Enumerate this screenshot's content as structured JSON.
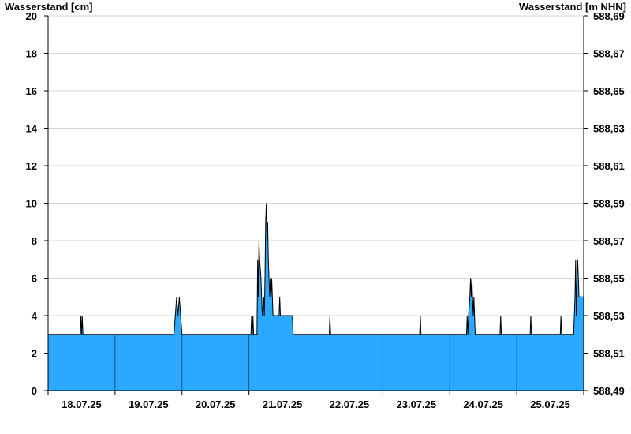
{
  "chart_data": {
    "type": "area",
    "y_left_label": "Wasserstand [cm]",
    "y_right_label": "Wasserstand [m NHN]",
    "ylim": [
      0,
      20
    ],
    "y_ticks": [
      "0",
      "2",
      "4",
      "6",
      "8",
      "10",
      "12",
      "14",
      "16",
      "18",
      "20"
    ],
    "y_right_ticks": [
      "588,49",
      "588,51",
      "588,53",
      "588,55",
      "588,57",
      "588,59",
      "588,61",
      "588,63",
      "588,65",
      "588,67",
      "588,69"
    ],
    "x_range_days": [
      17.0,
      25.0
    ],
    "x_tick_labels": [
      "18.07.25",
      "19.07.25",
      "20.07.25",
      "21.07.25",
      "22.07.25",
      "23.07.25",
      "24.07.25",
      "25.07.25"
    ],
    "grid": true,
    "fill_color": "#29a9ff",
    "line_color": "#000000",
    "series": [
      {
        "x": [
          17.0,
          17.48,
          17.49,
          17.5,
          17.51,
          17.52,
          18.88,
          18.9,
          18.92,
          18.94,
          18.96,
          18.98,
          19.0,
          19.02,
          20.03,
          20.04,
          20.05,
          20.06,
          20.07,
          20.12,
          20.13,
          20.14,
          20.15,
          20.16,
          20.18,
          20.2,
          20.22,
          20.23,
          20.24,
          20.25,
          20.26,
          20.27,
          20.28,
          20.29,
          20.3,
          20.31,
          20.32,
          20.33,
          20.34,
          20.35,
          20.36,
          20.37,
          20.38,
          20.4,
          20.45,
          20.46,
          20.47,
          20.48,
          20.55,
          20.56,
          20.65,
          20.66,
          21.2,
          21.21,
          21.22,
          21.23,
          22.55,
          22.56,
          22.57,
          22.58,
          23.25,
          23.26,
          23.27,
          23.28,
          23.3,
          23.31,
          23.32,
          23.33,
          23.34,
          23.35,
          23.36,
          23.37,
          23.38,
          23.4,
          23.42,
          23.43,
          23.75,
          23.76,
          23.77,
          23.78,
          24.2,
          24.21,
          24.22,
          24.23,
          24.65,
          24.66,
          24.67,
          24.68,
          24.85,
          24.86,
          24.87,
          24.88,
          24.89,
          24.9,
          24.91,
          24.92,
          24.93,
          24.95,
          25.0
        ],
        "y": [
          3,
          3,
          4,
          3,
          4,
          3,
          3,
          4,
          5,
          4,
          5,
          4,
          3,
          3,
          3,
          4,
          3,
          4,
          3,
          3,
          7,
          5,
          8,
          7,
          6,
          4,
          5,
          4,
          6,
          9,
          10,
          8,
          9,
          7,
          6,
          5,
          6,
          5,
          6,
          5,
          4,
          4,
          4,
          4,
          4,
          5,
          4,
          4,
          4,
          4,
          4,
          3,
          3,
          4,
          3,
          3,
          3,
          4,
          3,
          3,
          3,
          4,
          3,
          4,
          5,
          6,
          5,
          6,
          5,
          4,
          5,
          4,
          3,
          3,
          3,
          3,
          3,
          4,
          3,
          3,
          3,
          4,
          3,
          3,
          3,
          4,
          3,
          3,
          3,
          4,
          5,
          7,
          4,
          6,
          7,
          6,
          5,
          5,
          5
        ]
      }
    ]
  }
}
